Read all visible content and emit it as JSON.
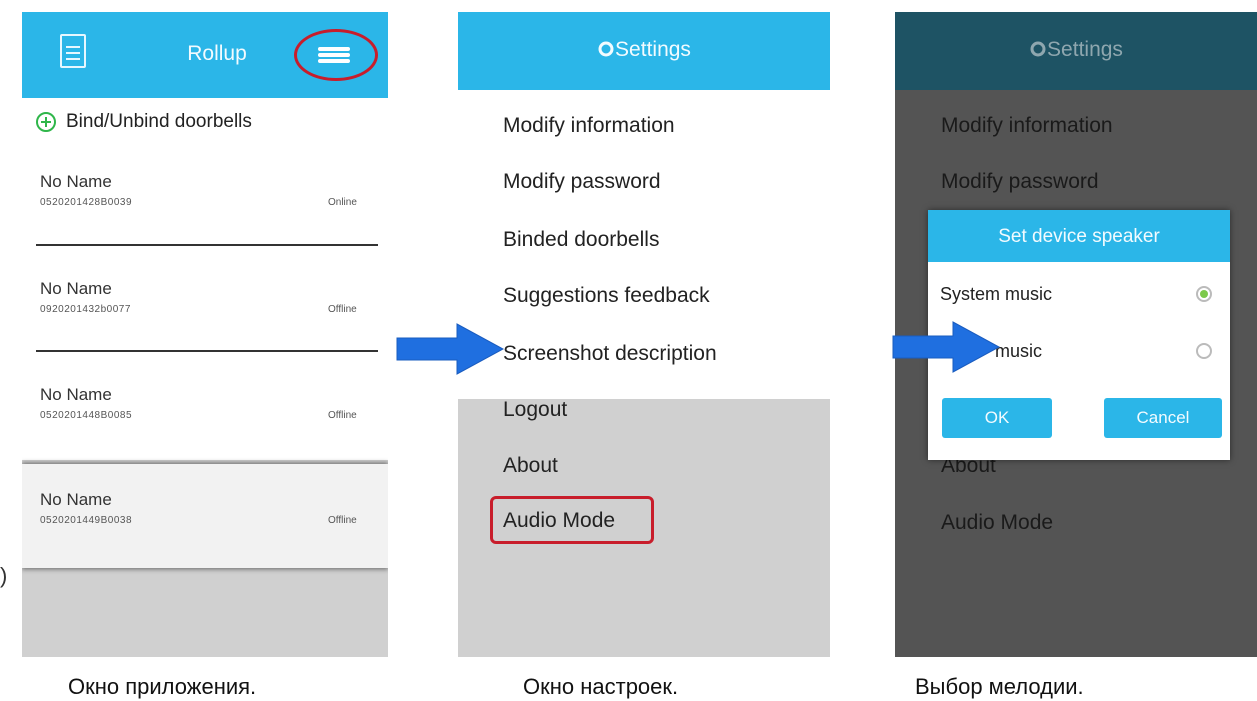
{
  "app_screen": {
    "title": "Rollup",
    "bind_label": "Bind/Unbind doorbells",
    "devices": [
      {
        "name": "No Name",
        "serial": "0520201428B0039",
        "status": "Online"
      },
      {
        "name": "No Name",
        "serial": "0920201432b0077",
        "status": "Offline"
      },
      {
        "name": "No Name",
        "serial": "0520201448B0085",
        "status": "Offline"
      },
      {
        "name": "No Name",
        "serial": "0520201449B0038",
        "status": "Offline"
      }
    ],
    "icons": {
      "document": "document-icon",
      "menu": "hamburger-menu-icon",
      "add": "plus-circle-icon"
    }
  },
  "settings_screen": {
    "title": "Settings",
    "items": [
      "Modify information",
      "Modify password",
      "Binded doorbells",
      "Suggestions feedback",
      "Screenshot description",
      "Logout",
      "About",
      "Audio Mode"
    ],
    "highlighted_item": "Audio Mode"
  },
  "speaker_screen": {
    "title": "Settings",
    "items_visible": [
      "Modify information",
      "Modify password",
      "About",
      "Audio Mode"
    ],
    "dialog": {
      "title": "Set device speaker",
      "options": [
        {
          "label": "System music",
          "selected": true
        },
        {
          "label": "music",
          "selected": false
        }
      ],
      "ok_label": "OK",
      "cancel_label": "Cancel"
    }
  },
  "captions": [
    "Окно приложения.",
    "Окно настроек.",
    "Выбор мелодии."
  ],
  "colors": {
    "accent": "#2bb6e8",
    "highlight": "#c81d2b",
    "arrow": "#1f6fe0",
    "radio_on": "#7cc94a"
  }
}
